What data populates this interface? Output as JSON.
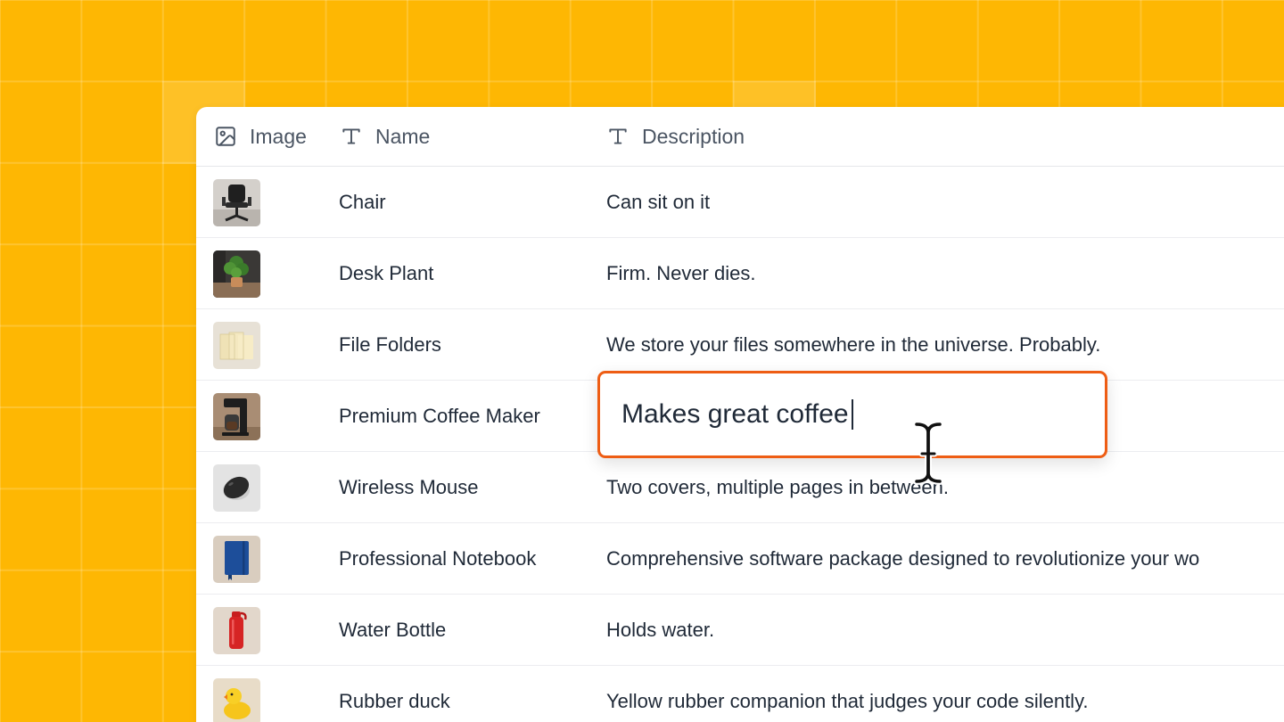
{
  "columns": [
    {
      "label": "Image",
      "icon": "image-icon"
    },
    {
      "label": "Name",
      "icon": "text-type-icon"
    },
    {
      "label": "Description",
      "icon": "text-type-icon"
    }
  ],
  "rows": [
    {
      "name": "Chair",
      "description": "Can sit on it",
      "thumb": "chair"
    },
    {
      "name": "Desk Plant",
      "description": "Firm. Never dies.",
      "thumb": "plant"
    },
    {
      "name": "File Folders",
      "description": "We store your files somewhere in the universe. Probably.",
      "thumb": "folders"
    },
    {
      "name": "Premium Coffee Maker",
      "description": "",
      "thumb": "coffee-maker"
    },
    {
      "name": "Wireless Mouse",
      "description": "Two covers, multiple pages in between.",
      "thumb": "mouse"
    },
    {
      "name": "Professional Notebook",
      "description": "Comprehensive software package designed to revolutionize your wo",
      "thumb": "notebook"
    },
    {
      "name": "Water Bottle",
      "description": "Holds water.",
      "thumb": "bottle"
    },
    {
      "name": "Rubber duck",
      "description": "Yellow rubber companion that judges your code silently.",
      "thumb": "duck"
    }
  ],
  "editor": {
    "value": "Makes great coffee"
  },
  "colors": {
    "background": "#FEB703",
    "accent": "#EE5D14"
  }
}
